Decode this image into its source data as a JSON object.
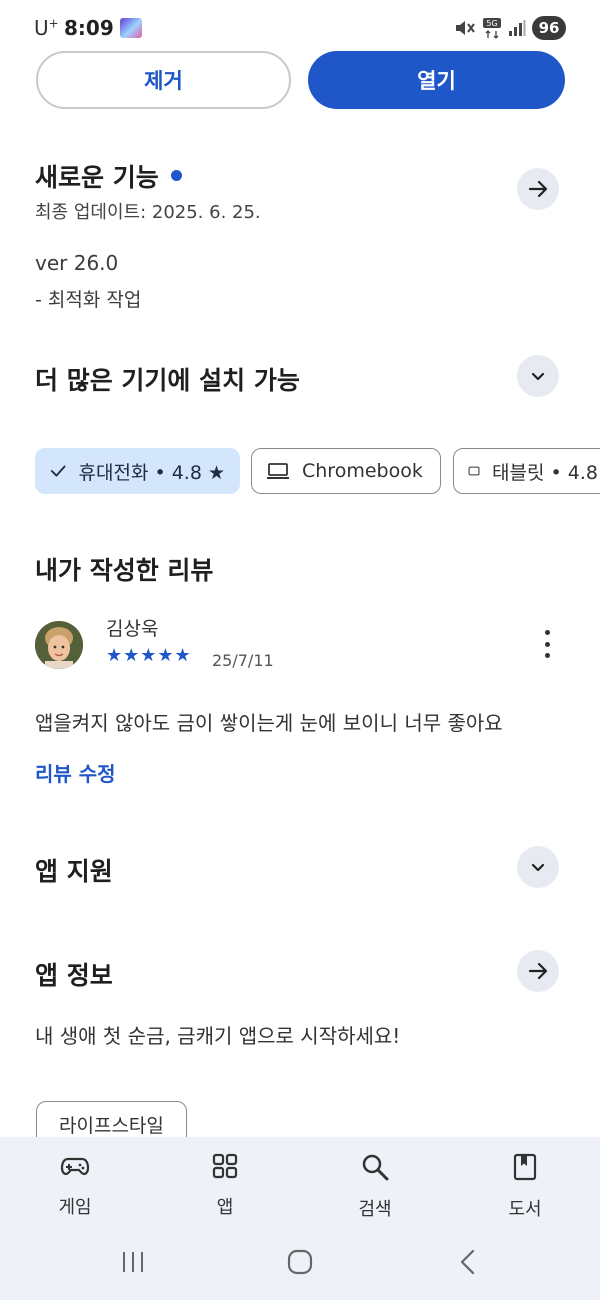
{
  "status_bar": {
    "carrier": "U",
    "carrier_sup": "+",
    "time": "8:09",
    "network": "5G",
    "battery": "96"
  },
  "actions": {
    "remove": "제거",
    "open": "열기"
  },
  "whats_new": {
    "title": "새로운 기능",
    "last_updated": "최종 업데이트: 2025. 6. 25.",
    "version": "ver 26.0",
    "notes": "- 최적화 작업"
  },
  "devices": {
    "title": "더 많은 기기에 설치 가능",
    "chips": [
      {
        "label": "휴대전화 • 4.8 ★",
        "icon": "check-icon",
        "selected": true
      },
      {
        "label": "Chromebook",
        "icon": "laptop-icon",
        "selected": false
      },
      {
        "label": "태블릿 • 4.8",
        "icon": "tablet-icon",
        "selected": false
      }
    ]
  },
  "my_review": {
    "title": "내가 작성한 리뷰",
    "reviewer": "김상욱",
    "stars": "★★★★★",
    "rating": 5,
    "date": "25/7/11",
    "text": "앱을켜지 않아도 금이 쌓이는게 눈에 보이니 너무 좋아요",
    "edit_label": "리뷰 수정"
  },
  "app_support": {
    "title": "앱 지원"
  },
  "app_info": {
    "title": "앱 정보",
    "description": "내 생애 첫 순금, 금캐기 앱으로 시작하세요!",
    "category": "라이프스타일"
  },
  "bottom_nav": [
    {
      "label": "게임",
      "icon": "gamepad-icon"
    },
    {
      "label": "앱",
      "icon": "apps-grid-icon"
    },
    {
      "label": "검색",
      "icon": "search-icon"
    },
    {
      "label": "도서",
      "icon": "book-icon"
    }
  ],
  "colors": {
    "accent": "#1f57c8",
    "chip_selected": "#d3e6fb",
    "nav_bg": "#eef2f8",
    "circle_btn": "#e7ebf1"
  }
}
